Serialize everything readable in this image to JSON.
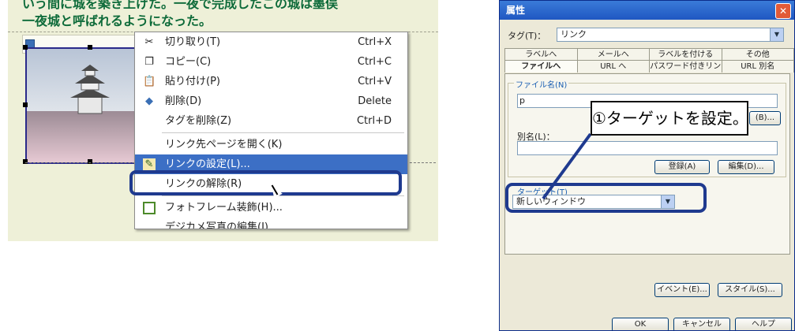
{
  "editor": {
    "text_line1": "いう間に城を築き上げた。一夜で完成したこの城は墨俣",
    "text_line2": "一夜城と呼ばれるようになった。"
  },
  "context_menu": {
    "items": [
      {
        "label": "切り取り(T)",
        "shortcut": "Ctrl+X",
        "icon": "scissors-icon"
      },
      {
        "label": "コピー(C)",
        "shortcut": "Ctrl+C",
        "icon": "copy-icon"
      },
      {
        "label": "貼り付け(P)",
        "shortcut": "Ctrl+V",
        "icon": "paste-icon"
      },
      {
        "label": "削除(D)",
        "shortcut": "Delete",
        "icon": "delete-icon"
      },
      {
        "label": "タグを削除(Z)",
        "shortcut": "Ctrl+D",
        "icon": ""
      },
      {
        "label": "リンク先ページを開く(K)",
        "shortcut": "",
        "icon": ""
      },
      {
        "label": "リンクの設定(L)...",
        "shortcut": "",
        "icon": "link-settings-icon"
      },
      {
        "label": "リンクの解除(R)",
        "shortcut": "",
        "icon": ""
      },
      {
        "label": "フォトフレーム装飾(H)...",
        "shortcut": "",
        "icon": "photo-frame-icon"
      },
      {
        "label": "デジカメ写真の編集(I)...",
        "shortcut": "",
        "icon": ""
      }
    ]
  },
  "dialog": {
    "title": "属性",
    "close": "✕",
    "tag_label": "タグ(T)：",
    "tag_value": "リンク",
    "tabs_row1": [
      "ラベルへ",
      "メールへ",
      "ラベルを付ける",
      "その他"
    ],
    "tabs_row2": [
      "ファイルへ",
      "URL へ",
      "パスワード付きリンク",
      "URL 別名"
    ],
    "file_legend": "ファイル名(N)",
    "file_value": "p",
    "browse_label": "(B)...",
    "alias_label": "別名(L)：",
    "register_button": "登録(A)",
    "edit_button": "編集(D)...",
    "target_label": "ターゲット(T)",
    "target_value": "新しいウィンドウ",
    "event_button": "イベント(E)...",
    "style_button": "スタイル(S)...",
    "ok_button": "OK",
    "cancel_button": "キャンセル",
    "help_button": "ヘルプ"
  },
  "callout": {
    "text": "①ターゲットを設定。"
  },
  "colors": {
    "highlight": "#3c6fc5",
    "annotation_ring": "#1f3a8f",
    "title_bar": "#1f57c2",
    "editor_text": "#0e6b3a"
  }
}
